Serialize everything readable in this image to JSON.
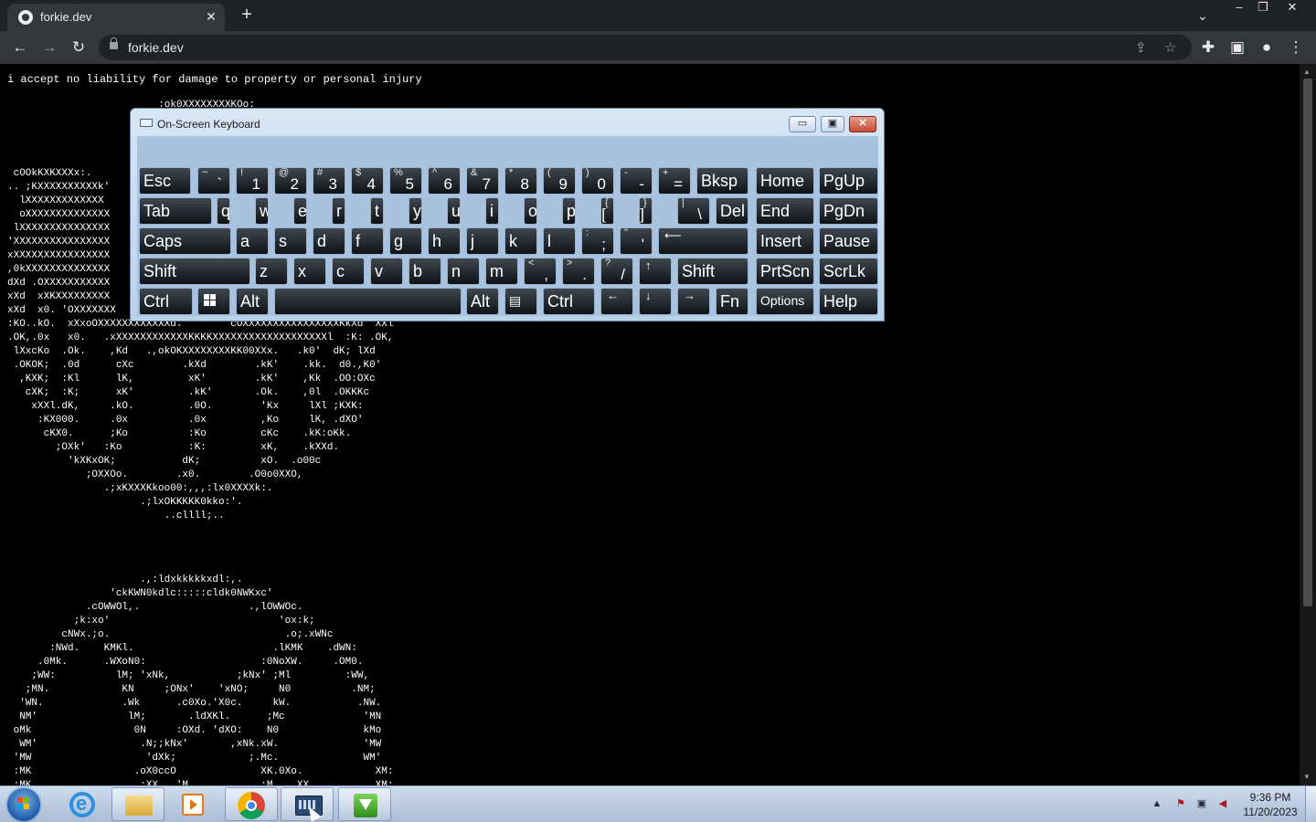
{
  "browser": {
    "tab_title": "forkie.dev",
    "tab_close": "✕",
    "new_tab": "+",
    "tab_search": "⌄",
    "window_minimize": "–",
    "window_restore": "❐",
    "window_close": "✕",
    "back": "←",
    "forward": "→",
    "reload": "↻",
    "url": "forkie.dev",
    "share": "⇪",
    "bookmark": "☆",
    "extensions": "✚",
    "sidepanel": "▣",
    "profile": "●",
    "menu": "⋮"
  },
  "page": {
    "disclaimer": "i accept no liability for damage to property or personal injury",
    "ascii_top_line": "  :ok0XXXXXXXXKOo:",
    "ascii_left": " cOOkKXKXXXx:.\n.. ;KXXXXXXXXXXk'\n  lXXXXXXXXXXXXX\n  oXXXXXXXXXXXXXX\n lXXXXXXXXXXXXXXX\n'XXXXXXXXXXXXXXXX\nxXXXXXXXXXXXXXXXX\n,0kXXXXXXXXXXXXXX\ndXd .OXXXXXXXXXXX\nxXd  xXKXXXXXXXXX\nxXd  x0. 'OXXXXXXX",
    "ascii_skull": ":KO..kO.  xXxoOXXXXXXXXXXXXd.        cOXXXXXXXXXXXXXXXXKkXd  XXl\n.OK,.0x   x0.   .xXXXXXXXXXXXXKKKKXXXXXXXXXXXXXXXXXXXl  :K: .OK,\n lXxcKo  .Ok.    ,Kd   .,okOKXXXXXXXXKK00XXx.   .k0'  dK; lXd\n .OKOK;  .0d      cXc        .kXd        .kK'    .kk.  d0.,K0'\n  ,KXK;  :Kl      lK,         xK'        .kK'    ,Kk  .OO:OXc\n   cXK;  :K;      xK'         .kK'       .Ok.    ,0l  .OKKKc\n    xXXl.dK,     .kO.         .0O.        'Kx     lXl ;KXK:\n     :KX000.     .0x          .0x         ,Ko     lK, .dXO'\n      cKX0.      ;Ko          :Ko         cKc    .kK:oKk.\n        ;OXk'   :Ko           :K:         xK,    .kXXd.\n          'kXKxOK;           dK;          xO.  .o00c\n             ;OXXOo.        .x0.        .O0o0XXO,\n                .;xKXXXKkoo00:,,,:lx0XXXXk:.\n                      .;lxOKKKKK0kko:'.\n                          ..cllll;..",
    "ascii_bottom": "                      .,:ldxkkkkkxdl:,.\n                 'ckKWN0kdlc:::::cldk0NWKxc'\n             .cOWWOl,.                  .,lOWWOc.\n           ;k:xo'                            'ox:k;\n         cNWx.;o.                             .o;.xWNc\n       :NWd.    KMKl.                       .lKMK    .dWN:\n     .0Mk.      .WXoN0:                   :0NoXW.     .OM0.\n    ;WW:          lM; 'xNk,           ;kNx' ;Ml         :WW,\n   ;MN.            KN     ;ONx'    'xNO;     N0          .NM;\n  'WN.             .Wk      .c0Xo.'X0c.     kW.           .NW.\n  NM'               lM;       .ldXKl.      ;Mc             'MN\n oMk                 0N     :OXd. 'dXO:    N0              kMo\n  WM'                 .N;;kNx'       ,xNk.xW.              'MW\n 'MW                   'dXk;            ;.Mc.              WM'\n :MK                 .oX0ccO              XK.0Xo.            XM:\n :MK                 .:XX.  'M.           :M.  .XX.          XM:"
  },
  "osk": {
    "title": "On-Screen Keyboard",
    "minimize": "▭",
    "maximize": "▣",
    "close": "✕",
    "rows": [
      [
        {
          "type": "label",
          "label": "Esc"
        },
        {
          "type": "dual",
          "shift": "~",
          "main": "`"
        },
        {
          "type": "dual",
          "shift": "!",
          "main": "1"
        },
        {
          "type": "dual",
          "shift": "@",
          "main": "2"
        },
        {
          "type": "dual",
          "shift": "#",
          "main": "3"
        },
        {
          "type": "dual",
          "shift": "$",
          "main": "4"
        },
        {
          "type": "dual",
          "shift": "%",
          "main": "5"
        },
        {
          "type": "dual",
          "shift": "^",
          "main": "6"
        },
        {
          "type": "dual",
          "shift": "&",
          "main": "7"
        },
        {
          "type": "dual",
          "shift": "*",
          "main": "8"
        },
        {
          "type": "dual",
          "shift": "(",
          "main": "9"
        },
        {
          "type": "dual",
          "shift": ")",
          "main": "0"
        },
        {
          "type": "dual",
          "shift": "-",
          "main": "-"
        },
        {
          "type": "dual",
          "shift": "+",
          "main": "="
        },
        {
          "type": "label",
          "label": "Bksp"
        },
        {
          "type": "label",
          "label": "Home"
        },
        {
          "type": "label",
          "label": "PgUp"
        }
      ],
      [
        {
          "type": "label",
          "label": "Tab"
        },
        {
          "type": "label",
          "label": "q"
        },
        {
          "type": "label",
          "label": "w"
        },
        {
          "type": "label",
          "label": "e"
        },
        {
          "type": "label",
          "label": "r"
        },
        {
          "type": "label",
          "label": "t"
        },
        {
          "type": "label",
          "label": "y"
        },
        {
          "type": "label",
          "label": "u"
        },
        {
          "type": "label",
          "label": "i"
        },
        {
          "type": "label",
          "label": "o"
        },
        {
          "type": "label",
          "label": "p"
        },
        {
          "type": "dual",
          "shift": "{",
          "main": "["
        },
        {
          "type": "dual",
          "shift": "}",
          "main": "]"
        },
        {
          "type": "dual",
          "shift": "|",
          "main": "\\"
        },
        {
          "type": "label",
          "label": "Del"
        },
        {
          "type": "label",
          "label": "End"
        },
        {
          "type": "label",
          "label": "PgDn"
        }
      ],
      [
        {
          "type": "label",
          "label": "Caps"
        },
        {
          "type": "label",
          "label": "a"
        },
        {
          "type": "label",
          "label": "s"
        },
        {
          "type": "label",
          "label": "d"
        },
        {
          "type": "label",
          "label": "f"
        },
        {
          "type": "label",
          "label": "g"
        },
        {
          "type": "label",
          "label": "h"
        },
        {
          "type": "label",
          "label": "j"
        },
        {
          "type": "label",
          "label": "k"
        },
        {
          "type": "label",
          "label": "l"
        },
        {
          "type": "dual",
          "shift": ":",
          "main": ";"
        },
        {
          "type": "dual",
          "shift": "\"",
          "main": "'"
        },
        {
          "type": "arrow",
          "label": "⟵"
        },
        {
          "type": "label",
          "label": "Insert"
        },
        {
          "type": "label",
          "label": "Pause"
        }
      ],
      [
        {
          "type": "label",
          "label": "Shift"
        },
        {
          "type": "label",
          "label": "z"
        },
        {
          "type": "label",
          "label": "x"
        },
        {
          "type": "label",
          "label": "c"
        },
        {
          "type": "label",
          "label": "v"
        },
        {
          "type": "label",
          "label": "b"
        },
        {
          "type": "label",
          "label": "n"
        },
        {
          "type": "label",
          "label": "m"
        },
        {
          "type": "dual",
          "shift": "<",
          "main": ","
        },
        {
          "type": "dual",
          "shift": ">",
          "main": "."
        },
        {
          "type": "dual",
          "shift": "?",
          "main": "/"
        },
        {
          "type": "arrow",
          "label": "↑"
        },
        {
          "type": "label",
          "label": "Shift"
        },
        {
          "type": "label",
          "label": "PrtScn"
        },
        {
          "type": "label",
          "label": "ScrLk"
        }
      ],
      [
        {
          "type": "label",
          "label": "Ctrl"
        },
        {
          "type": "winlogo",
          "label": ""
        },
        {
          "type": "label",
          "label": "Alt"
        },
        {
          "type": "label",
          "label": ""
        },
        {
          "type": "label",
          "label": "Alt"
        },
        {
          "type": "small",
          "label": "▤"
        },
        {
          "type": "label",
          "label": "Ctrl"
        },
        {
          "type": "arrow",
          "label": "←"
        },
        {
          "type": "arrow",
          "label": "↓"
        },
        {
          "type": "arrow",
          "label": "→"
        },
        {
          "type": "label",
          "label": "Fn"
        },
        {
          "type": "small",
          "label": "Options"
        },
        {
          "type": "label",
          "label": "Help"
        }
      ]
    ]
  },
  "taskbar": {
    "tray_show_hidden": "▲",
    "tray_flag": "⚑",
    "tray_network": "▣",
    "tray_volume": "◀",
    "time": "9:36 PM",
    "date": "11/20/2023"
  }
}
